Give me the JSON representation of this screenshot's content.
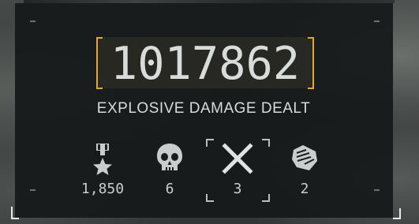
{
  "hud": {
    "score_value": "1017862",
    "score_label": "EXPLOSIVE DAMAGE DEALT",
    "accent_color": "#e3a63a",
    "text_color": "#d8dcdb"
  },
  "stats": [
    {
      "icon": "medal-star-icon",
      "value": "1,850"
    },
    {
      "icon": "skull-icon",
      "value": "6"
    },
    {
      "icon": "crossed-swords-icon",
      "value": "3",
      "selected": true
    },
    {
      "icon": "fist-icon",
      "value": "2"
    }
  ]
}
